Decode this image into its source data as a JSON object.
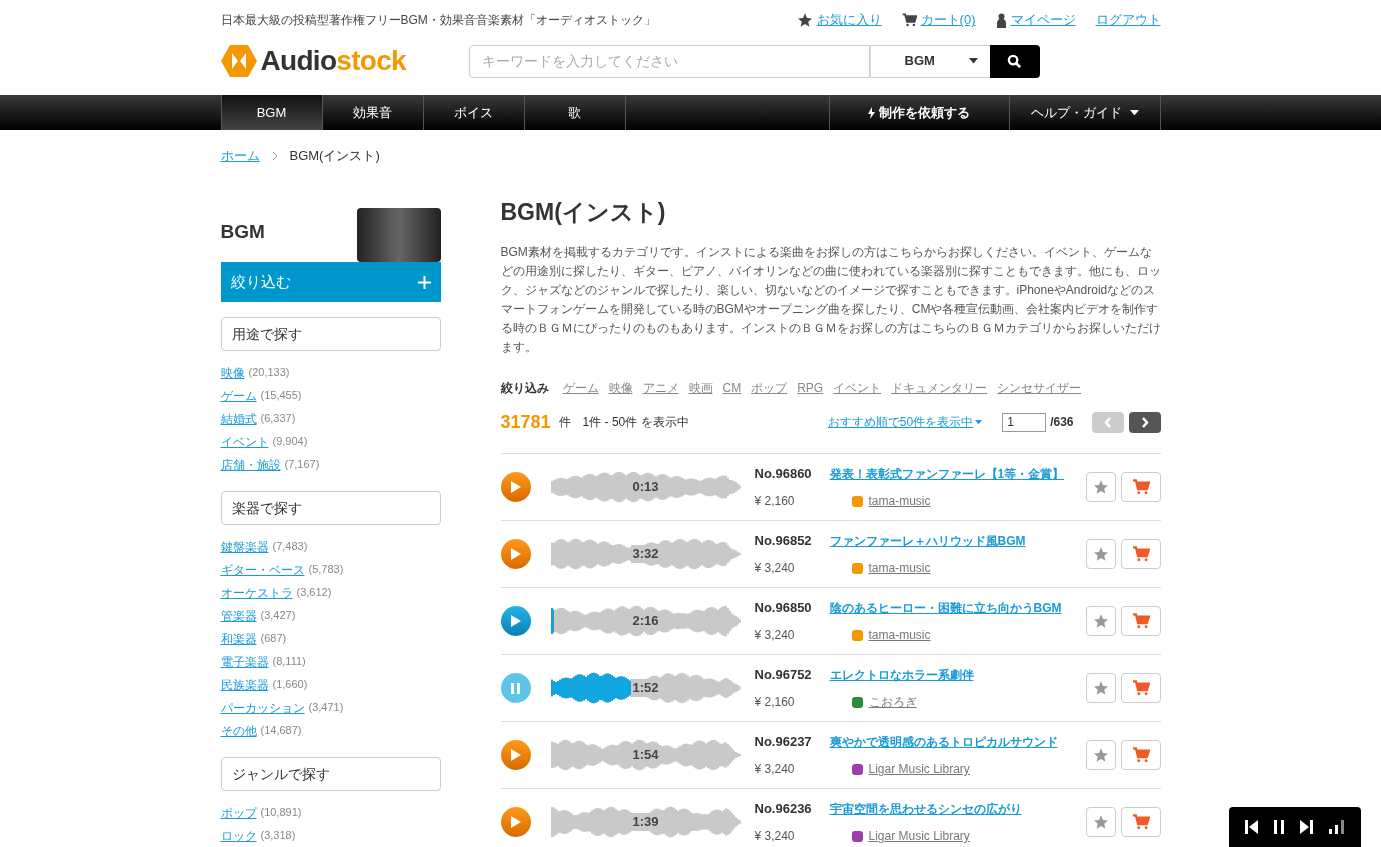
{
  "header": {
    "tagline": "日本最大級の投稿型著作権フリーBGM・効果音音楽素材「オーディオストック」",
    "links": [
      {
        "kind": "favorite",
        "label": "お気に入り"
      },
      {
        "kind": "cart",
        "label": "カート(0)"
      },
      {
        "kind": "user",
        "label": "マイページ"
      },
      {
        "kind": "plain",
        "label": "ログアウト"
      }
    ],
    "logo": {
      "part_1": "Audio",
      "part_2": "stock"
    },
    "search": {
      "placeholder": "キーワードを入力してください",
      "category": "BGM"
    }
  },
  "nav": {
    "left": [
      {
        "label": "BGM",
        "selected": true
      },
      {
        "label": "効果音",
        "selected": false
      },
      {
        "label": "ボイス",
        "selected": false
      },
      {
        "label": "歌",
        "selected": false
      }
    ],
    "request": "制作を依頼する",
    "help": "ヘルプ・ガイド"
  },
  "breadcrumb": {
    "home": "ホーム",
    "current": "BGM(インスト)"
  },
  "sidebar": {
    "title": "BGM",
    "filter_button": "絞り込む",
    "sections": [
      {
        "title": "用途で探す",
        "items": [
          {
            "label": "映像",
            "count": "(20,133)"
          },
          {
            "label": "ゲーム",
            "count": "(15,455)"
          },
          {
            "label": "結婚式",
            "count": "(6,337)"
          },
          {
            "label": "イベント",
            "count": "(9,904)"
          },
          {
            "label": "店舗・施設",
            "count": "(7,167)"
          }
        ]
      },
      {
        "title": "楽器で探す",
        "items": [
          {
            "label": "鍵盤楽器",
            "count": "(7,483)"
          },
          {
            "label": "ギター・ベース",
            "count": "(5,783)"
          },
          {
            "label": "オーケストラ",
            "count": "(3,612)"
          },
          {
            "label": "管楽器",
            "count": "(3,427)"
          },
          {
            "label": "和楽器",
            "count": "(687)"
          },
          {
            "label": "電子楽器",
            "count": "(8,111)"
          },
          {
            "label": "民族楽器",
            "count": "(1,660)"
          },
          {
            "label": "パーカッション",
            "count": "(3,471)"
          },
          {
            "label": "その他",
            "count": "(14,687)"
          }
        ]
      },
      {
        "title": "ジャンルで探す",
        "items": [
          {
            "label": "ポップ",
            "count": "(10,891)"
          },
          {
            "label": "ロック",
            "count": "(3,318)"
          }
        ]
      }
    ]
  },
  "main": {
    "title": "BGM(インスト)",
    "description": "BGM素材を掲載するカテゴリです。インストによる楽曲をお探しの方はこちらからお探しください。イベント、ゲームなどの用途別に探したり、ギター、ピアノ、バイオリンなどの曲に使われている楽器別に探すこともできます。他にも、ロック、ジャズなどのジャンルで探したり、楽しい、切ないなどのイメージで探すこともできます。iPhoneやAndroidなどのスマートフォンゲームを開発している時のBGMやオープニング曲を探したり、CMや各種宣伝動画、会社案内ビデオを制作する時のＢＧＭにぴったりのものもあります。インストのＢＧＭをお探しの方はこちらのＢＧＭカテゴリからお探しいただけます。",
    "filter_label": "絞り込み",
    "filter_tags": [
      "ゲーム",
      "映像",
      "アニメ",
      "映画",
      "CM",
      "ポップ",
      "RPG",
      "イベント",
      "ドキュメンタリー",
      "シンセサイザー"
    ],
    "total": "31781",
    "total_unit": "件",
    "range": "1件 - 50件 を表示中",
    "sort": "おすすめ順で50件を表示中",
    "page": "1",
    "pages": "/636",
    "tracks": [
      {
        "number": "No.96860",
        "title": "発表！表彰式ファンファーレ【1等・金賞】",
        "price": "¥ 2,160",
        "artist": {
          "name": "tama-music",
          "color": "#f39800"
        },
        "duration": "0:13",
        "playing": false,
        "level": 0
      },
      {
        "number": "No.96852",
        "title": "ファンファーレ＋ハリウッド風BGM",
        "price": "¥ 3,240",
        "artist": {
          "name": "tama-music",
          "color": "#f39800"
        },
        "duration": "3:32",
        "playing": false,
        "level": 0
      },
      {
        "number": "No.96850",
        "title": "陰のあるヒーロー・困難に立ち向かうBGM",
        "price": "¥ 3,240",
        "artist": {
          "name": "tama-music",
          "color": "#f39800"
        },
        "duration": "2:16",
        "playing": false,
        "level": 0.02
      },
      {
        "number": "No.96752",
        "title": "エレクトロなホラー系劇伴",
        "price": "¥ 2,160",
        "artist": {
          "name": "こおろぎ",
          "color": "#2e8b3a"
        },
        "duration": "1:52",
        "playing": true,
        "level": 0.44
      },
      {
        "number": "No.96237",
        "title": "爽やかで透明感のあるトロピカルサウンド",
        "price": "¥ 3,240",
        "artist": {
          "name": "Ligar Music Library",
          "color": "#9b3fa8"
        },
        "duration": "1:54",
        "playing": false,
        "level": 0
      },
      {
        "number": "No.96236",
        "title": "宇宙空間を思わせるシンセの広がり",
        "price": "¥ 3,240",
        "artist": {
          "name": "Ligar Music Library",
          "color": "#9b3fa8"
        },
        "duration": "1:39",
        "playing": false,
        "level": 0
      }
    ]
  }
}
